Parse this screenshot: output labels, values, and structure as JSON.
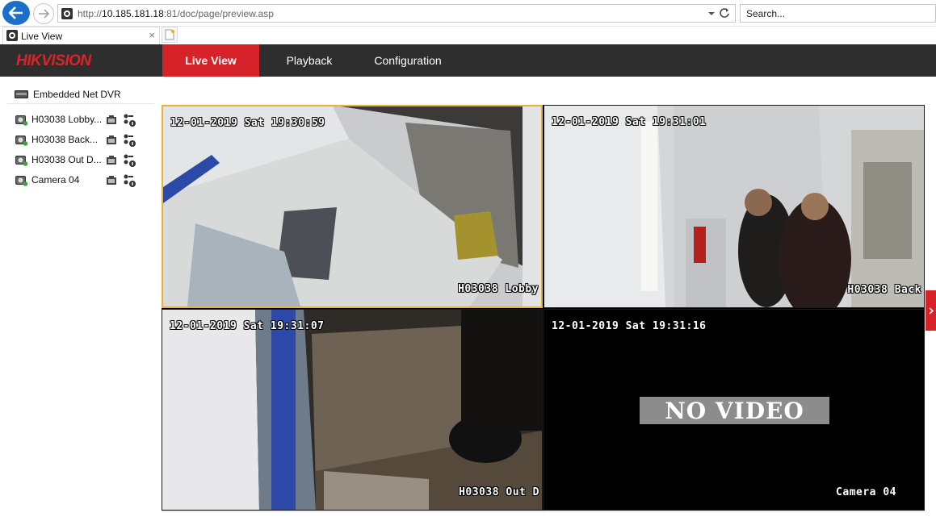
{
  "browser": {
    "url_prefix": "http://",
    "url_host": "10.185.181.18",
    "url_rest": ":81/doc/page/preview.asp",
    "search_placeholder": "Search...",
    "tab_title": "Live View",
    "tab_close": "×"
  },
  "app": {
    "logo": "HIKVISION",
    "nav": {
      "live_view": "Live View",
      "playback": "Playback",
      "configuration": "Configuration"
    },
    "active_tab": "Live View",
    "accent_color": "#d6232a"
  },
  "sidebar": {
    "device": "Embedded Net DVR",
    "cameras": [
      {
        "label": "H03038 Lobby..."
      },
      {
        "label": "H03038 Back..."
      },
      {
        "label": "H03038 Out D..."
      },
      {
        "label": "Camera 04"
      }
    ]
  },
  "grid": {
    "panes": [
      {
        "timestamp": "12-01-2019 Sat 19:30:59",
        "name": "H03038 Lobby"
      },
      {
        "timestamp": "12-01-2019 Sat 19:31:01",
        "name": "H03038 Back"
      },
      {
        "timestamp": "12-01-2019 Sat 19:31:07",
        "name": "H03038 Out D"
      },
      {
        "timestamp": "12-01-2019 Sat 19:31:16",
        "name": "Camera 04",
        "status": "NO VIDEO"
      }
    ]
  }
}
